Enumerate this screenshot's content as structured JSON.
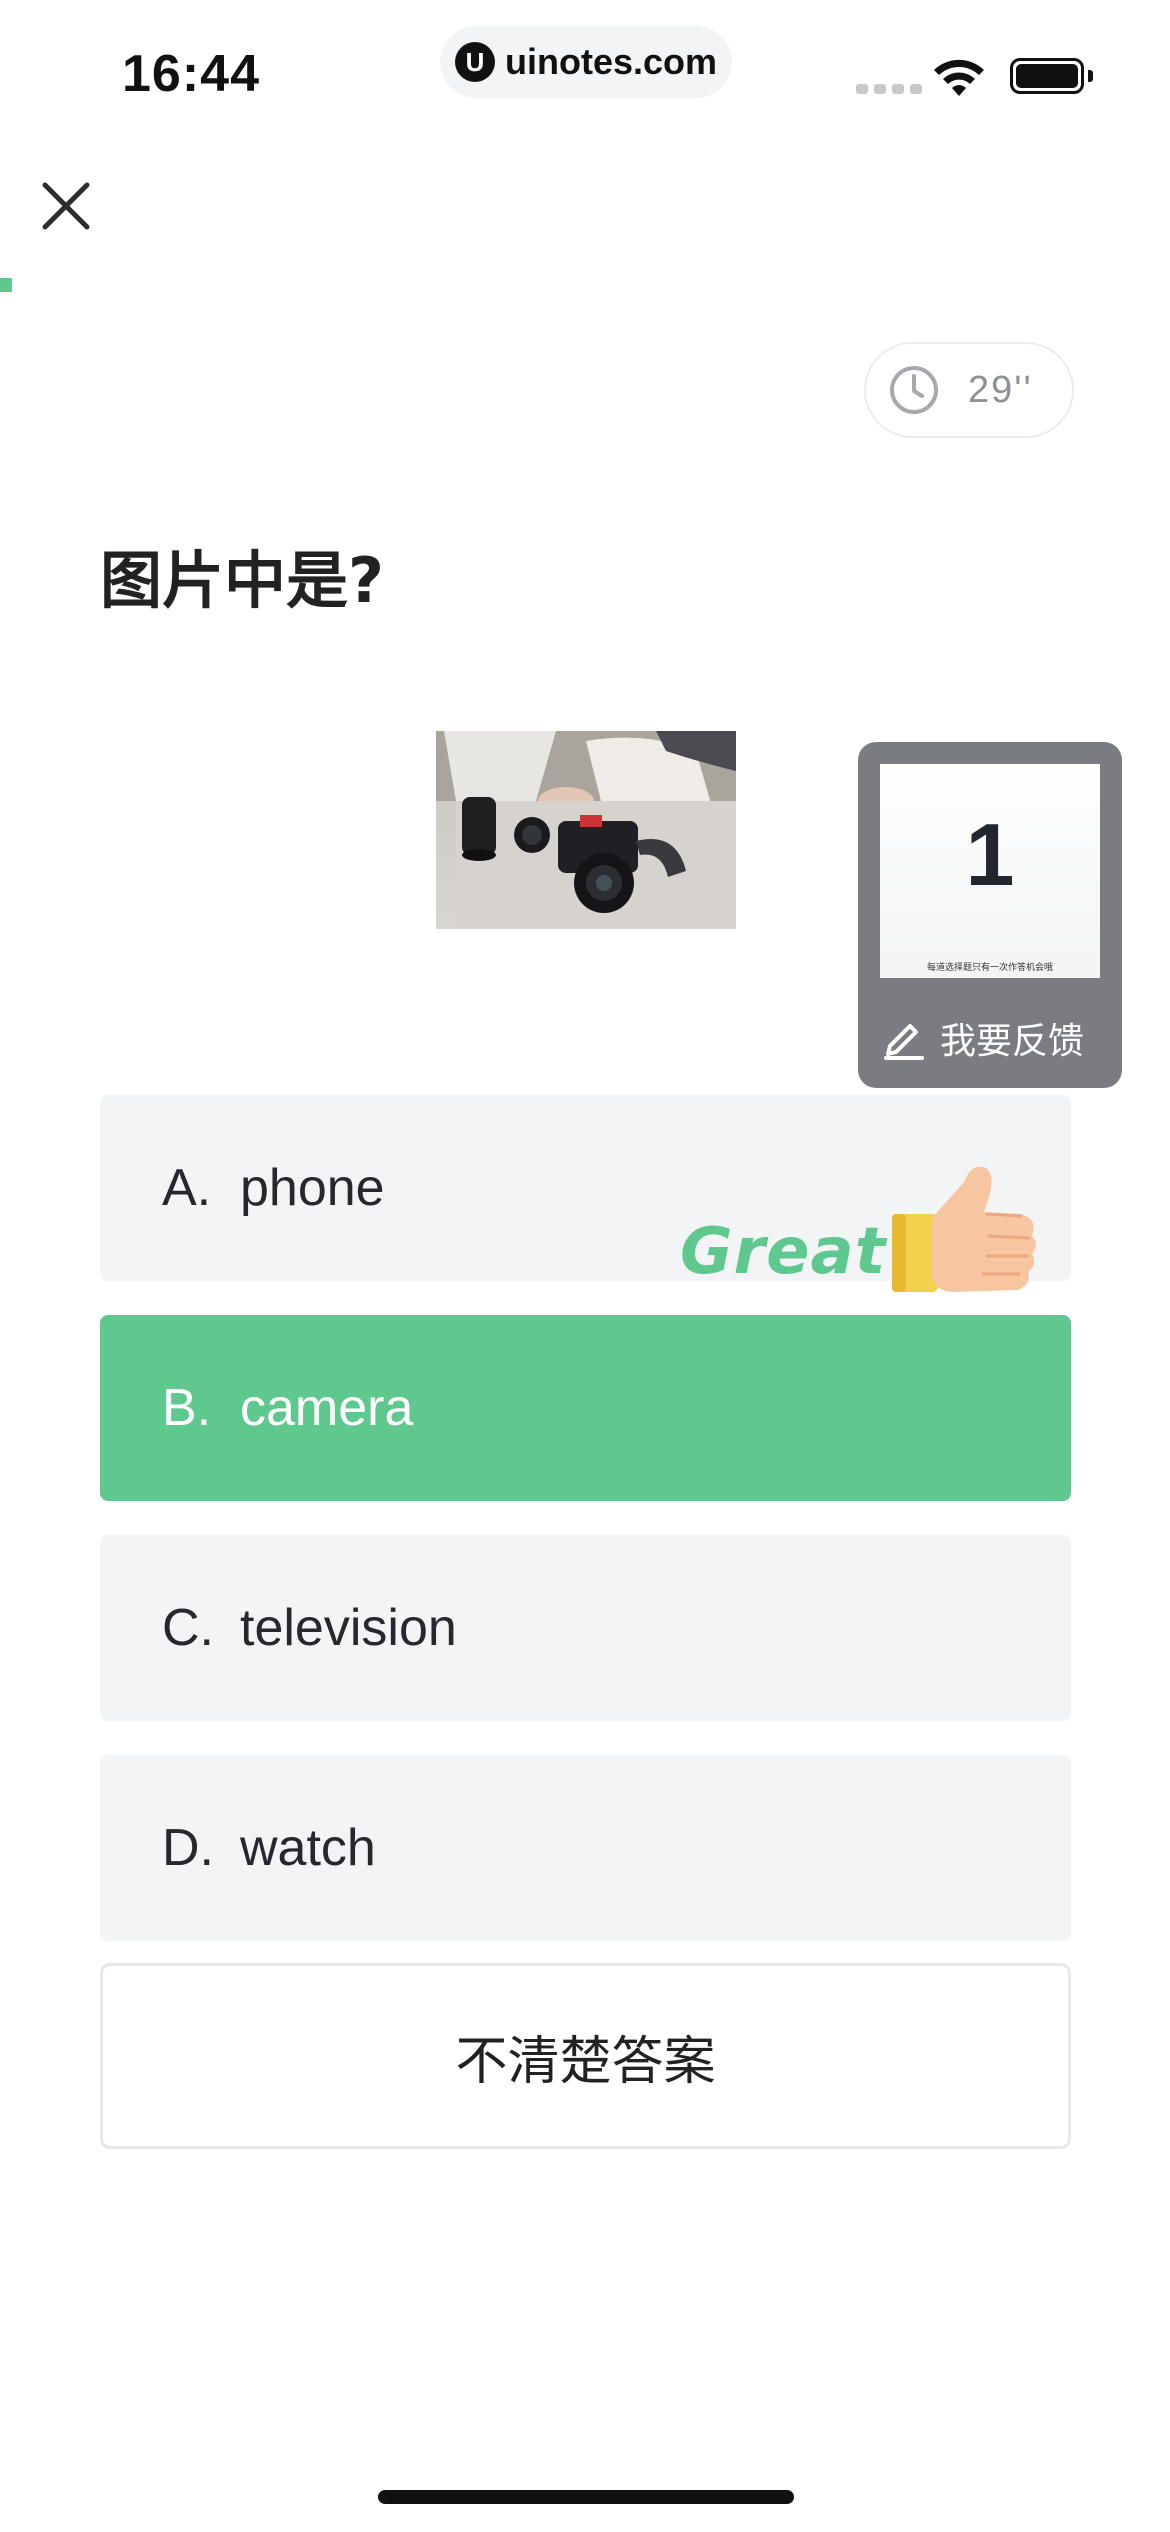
{
  "status_bar": {
    "time": "16:44",
    "url": "uinotes.com",
    "url_logo": "U"
  },
  "icons": {
    "close": "close-icon",
    "timer": "clock-icon",
    "feedback": "pencil-icon",
    "praise": "thumbs-up-icon"
  },
  "timer": {
    "text": "29''"
  },
  "question": {
    "title": "图片中是?"
  },
  "feedback": {
    "thumb_number": "1",
    "thumb_caption": "每道选择题只有一次作答机会哦",
    "label": "我要反馈"
  },
  "options": [
    {
      "letter": "A.",
      "text": "phone",
      "selected": false
    },
    {
      "letter": "B.",
      "text": "camera",
      "selected": true
    },
    {
      "letter": "C.",
      "text": "television",
      "selected": false
    },
    {
      "letter": "D.",
      "text": "watch",
      "selected": false
    }
  ],
  "praise": {
    "text": "Great"
  },
  "unknown_button": {
    "label": "不清楚答案"
  },
  "colors": {
    "accent": "#5ec88f",
    "option_bg": "#f3f4f6",
    "feedback_bg": "#7b7c82"
  }
}
